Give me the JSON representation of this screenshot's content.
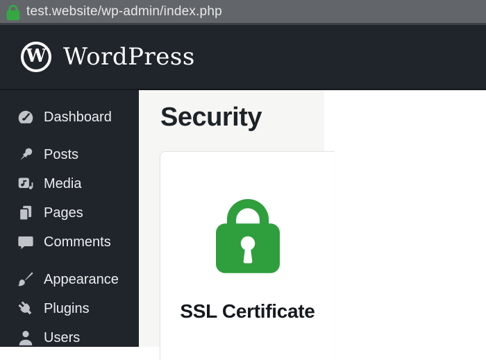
{
  "browser": {
    "url": "test.website/wp-admin/index.php",
    "lock_icon": "secure-padlock-icon",
    "bar_color": "#626569"
  },
  "admin_header": {
    "brand": "WordPress",
    "logo_letter": "W",
    "logo_icon": "wordpress-logo",
    "bg_color": "#20252c"
  },
  "sidebar": {
    "items": [
      {
        "label": "Dashboard",
        "icon": "dashboard-gauge-icon"
      },
      {
        "label": "Posts",
        "icon": "pushpin-icon"
      },
      {
        "label": "Media",
        "icon": "media-icon"
      },
      {
        "label": "Pages",
        "icon": "pages-icon"
      },
      {
        "label": "Comments",
        "icon": "comment-bubble-icon"
      },
      {
        "label": "Appearance",
        "icon": "paintbrush-icon"
      },
      {
        "label": "Plugins",
        "icon": "plug-icon"
      },
      {
        "label": "Users",
        "icon": "user-icon"
      }
    ]
  },
  "main": {
    "page_title": "Security",
    "card": {
      "title": "SSL Certificate",
      "icon": "ssl-lock-icon",
      "icon_color": "#2f9e3d"
    }
  },
  "colors": {
    "green": "#2f9e3d",
    "header_bg": "#20252c",
    "content_bg": "#f6f6f5",
    "card_border": "#e2e2e4"
  }
}
